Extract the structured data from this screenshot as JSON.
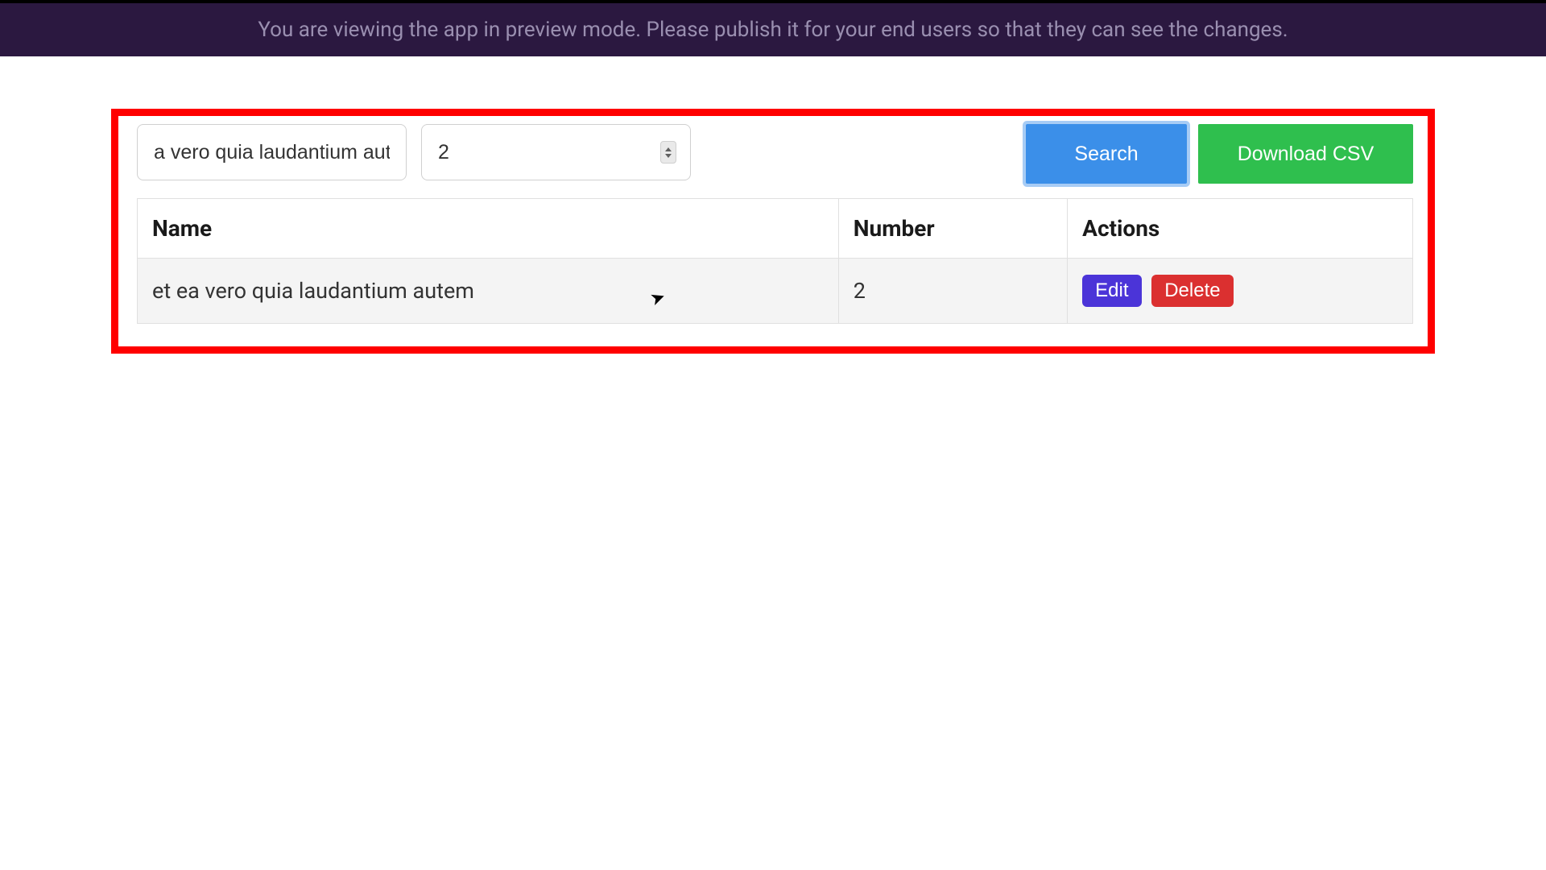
{
  "banner": {
    "message": "You are viewing the app in preview mode. Please publish it for your end users so that they can see the changes."
  },
  "toolbar": {
    "name_input_value": "a vero quia laudantium autem",
    "number_input_value": "2",
    "search_label": "Search",
    "download_label": "Download CSV"
  },
  "table": {
    "headers": {
      "name": "Name",
      "number": "Number",
      "actions": "Actions"
    },
    "rows": [
      {
        "name": "et ea vero quia laudantium autem",
        "number": "2",
        "edit_label": "Edit",
        "delete_label": "Delete"
      }
    ]
  }
}
